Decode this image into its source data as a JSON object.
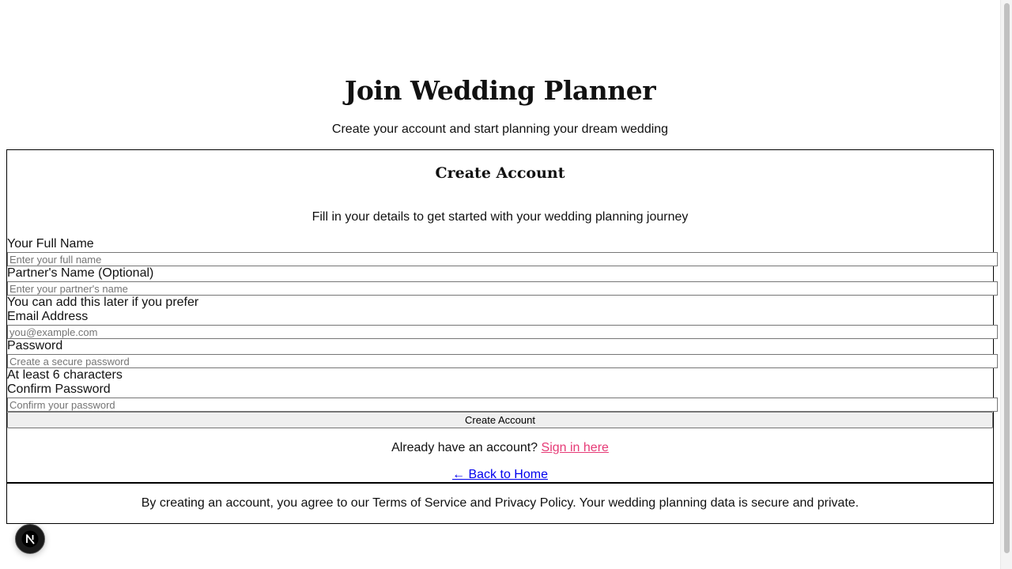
{
  "header": {
    "title": "Join Wedding Planner",
    "subtitle": "Create your account and start planning your dream wedding"
  },
  "form": {
    "title": "Create Account",
    "description": "Fill in your details to get started with your wedding planning journey",
    "full_name": {
      "label": "Your Full Name",
      "placeholder": "Enter your full name",
      "value": ""
    },
    "partner_name": {
      "label": "Partner's Name (Optional)",
      "placeholder": "Enter your partner's name",
      "value": "",
      "hint": "You can add this later if you prefer"
    },
    "email": {
      "label": "Email Address",
      "placeholder": "you@example.com",
      "value": ""
    },
    "password": {
      "label": "Password",
      "placeholder": "Create a secure password",
      "value": "",
      "hint": "At least 6 characters"
    },
    "confirm_password": {
      "label": "Confirm Password",
      "placeholder": "Confirm your password",
      "value": ""
    },
    "submit_label": "Create Account",
    "signin_prompt": "Already have an account?",
    "signin_link": "Sign in here",
    "back_link": "← Back to Home"
  },
  "footer": {
    "note": "By creating an account, you agree to our Terms of Service and Privacy Policy. Your wedding planning data is secure and private."
  },
  "dev_badge": {
    "icon": "nextjs-logo-icon",
    "letter": "N"
  },
  "colors": {
    "accent_link": "#e63a76",
    "default_link": "#0000ee",
    "badge_bg": "#1a1a1a"
  }
}
